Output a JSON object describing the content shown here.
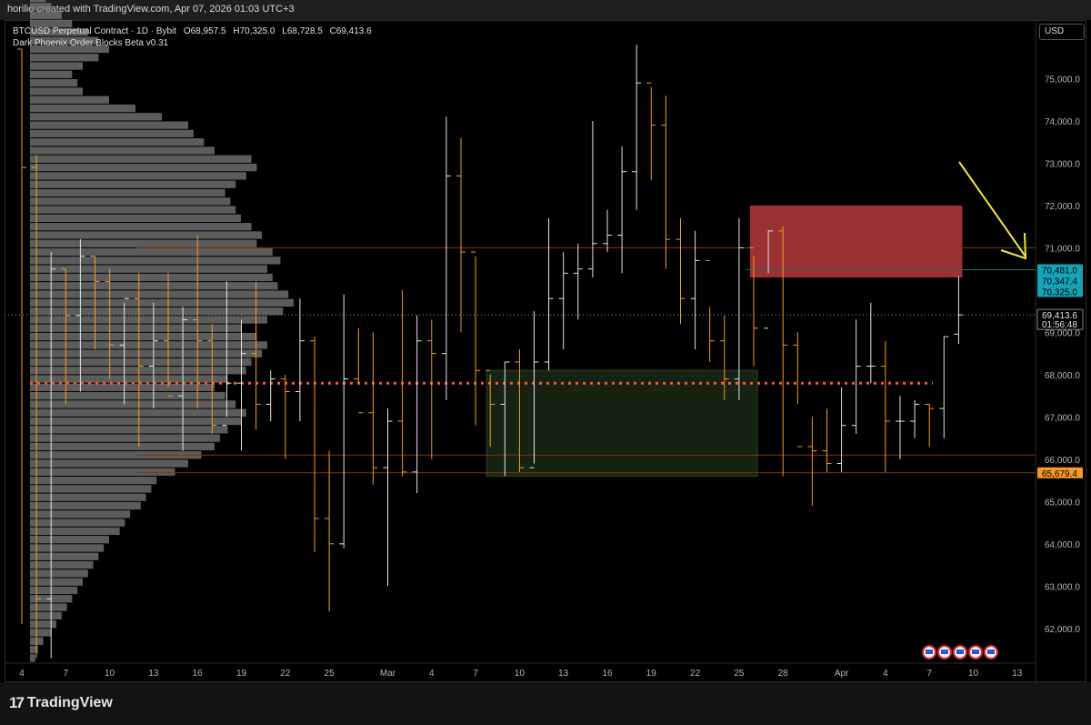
{
  "header": {
    "attribution": "horilio created with TradingView.com, Apr 07, 2026 01:03 UTC+3"
  },
  "legend": {
    "symbol": "BTCUSD Perpetual Contract · 1D · Bybit",
    "open": "O68,957.5",
    "high": "H70,325.0",
    "low": "L68,728.5",
    "close": "C69,413.6",
    "indicator": "Dark Phoenix Order Blocks Beta v0.31"
  },
  "currency": "USD",
  "brand": {
    "name": "TradingView"
  },
  "colors": {
    "up": "#e6e6e6",
    "down": "#f59a23",
    "bearish_block": "#b73a3d",
    "bullish_block": "#1c2b17",
    "poc": "#ff5a1f",
    "price_label": "#15a3b8",
    "support_label": "#f59a23",
    "arrow": "#f5e53a"
  },
  "chart_data": {
    "type": "ohlc",
    "y_ticks": [
      62000,
      63000,
      64000,
      65000,
      66000,
      67000,
      68000,
      69000,
      70000,
      71000,
      72000,
      73000,
      74000,
      75000
    ],
    "y_tick_labels": [
      "62,000.0",
      "63,000.0",
      "64,000.0",
      "65,000.0",
      "66,000.0",
      "67,000.0",
      "68,000.0",
      "69,000.0",
      "70,000.0",
      "71,000.0",
      "72,000.0",
      "73,000.0",
      "74,000.0",
      "75,000.0"
    ],
    "ylim": [
      61200,
      76000
    ],
    "x_labels": [
      {
        "i": 0,
        "label": "4"
      },
      {
        "i": 3,
        "label": "7"
      },
      {
        "i": 6,
        "label": "10"
      },
      {
        "i": 9,
        "label": "13"
      },
      {
        "i": 12,
        "label": "16"
      },
      {
        "i": 15,
        "label": "19"
      },
      {
        "i": 18,
        "label": "22"
      },
      {
        "i": 21,
        "label": "25"
      },
      {
        "i": 25,
        "label": "Mar"
      },
      {
        "i": 28,
        "label": "4"
      },
      {
        "i": 31,
        "label": "7"
      },
      {
        "i": 34,
        "label": "10"
      },
      {
        "i": 37,
        "label": "13"
      },
      {
        "i": 40,
        "label": "16"
      },
      {
        "i": 43,
        "label": "19"
      },
      {
        "i": 46,
        "label": "22"
      },
      {
        "i": 49,
        "label": "25"
      },
      {
        "i": 52,
        "label": "28"
      },
      {
        "i": 56,
        "label": "Apr"
      },
      {
        "i": 59,
        "label": "4"
      },
      {
        "i": 62,
        "label": "7"
      },
      {
        "i": 65,
        "label": "10"
      },
      {
        "i": 68,
        "label": "13"
      }
    ],
    "ohlc": [
      [
        75700,
        75700,
        62100,
        72900
      ],
      [
        72900,
        73200,
        61300,
        62700
      ],
      [
        62700,
        70900,
        61300,
        70500
      ],
      [
        70500,
        70500,
        67300,
        69400
      ],
      [
        69400,
        71200,
        67600,
        70800
      ],
      [
        70800,
        70800,
        68600,
        70200
      ],
      [
        70200,
        70500,
        67900,
        68700
      ],
      [
        68700,
        69700,
        67300,
        69800
      ],
      [
        69800,
        70400,
        66300,
        68200
      ],
      [
        68200,
        69700,
        67200,
        68800
      ],
      [
        68800,
        70400,
        67700,
        67500
      ],
      [
        67500,
        69600,
        66200,
        69300
      ],
      [
        69300,
        71300,
        67200,
        68800
      ],
      [
        68800,
        69200,
        66600,
        66800
      ],
      [
        66800,
        70200,
        67000,
        67800
      ],
      [
        67800,
        69300,
        66200,
        68500
      ],
      [
        68500,
        70200,
        66700,
        67300
      ],
      [
        67300,
        68100,
        66900,
        67900
      ],
      [
        67900,
        68000,
        66000,
        67600
      ],
      [
        67600,
        69800,
        66900,
        68800
      ],
      [
        68800,
        68900,
        63800,
        64600
      ],
      [
        64600,
        66200,
        62400,
        64000
      ],
      [
        64000,
        69900,
        63900,
        67900
      ],
      [
        67900,
        69100,
        67800,
        67100
      ],
      [
        67100,
        69000,
        65400,
        65800
      ],
      [
        65800,
        67200,
        63000,
        66900
      ],
      [
        66900,
        70000,
        65600,
        65700
      ],
      [
        65700,
        69400,
        65200,
        68800
      ],
      [
        68800,
        69300,
        66000,
        68500
      ],
      [
        68500,
        74100,
        67400,
        72700
      ],
      [
        72700,
        73600,
        69000,
        70900
      ],
      [
        70900,
        70800,
        66800,
        68100
      ],
      [
        68100,
        68000,
        66300,
        67300
      ],
      [
        67300,
        68300,
        65600,
        68300
      ],
      [
        68300,
        68600,
        65700,
        65800
      ],
      [
        65800,
        69500,
        65900,
        68300
      ],
      [
        68300,
        71700,
        68100,
        69800
      ],
      [
        69800,
        70900,
        68600,
        70400
      ],
      [
        70400,
        71100,
        69300,
        70500
      ],
      [
        70500,
        74000,
        70300,
        71100
      ],
      [
        71100,
        71900,
        70900,
        71300
      ],
      [
        71300,
        73400,
        70400,
        72800
      ],
      [
        72800,
        75800,
        71900,
        74900
      ],
      [
        74900,
        74800,
        72600,
        73900
      ],
      [
        73900,
        74600,
        70500,
        71200
      ],
      [
        71200,
        71700,
        69200,
        69800
      ],
      [
        69800,
        71400,
        68600,
        70700
      ],
      [
        70700,
        69600,
        68300,
        68800
      ],
      [
        68800,
        69400,
        67400,
        67900
      ],
      [
        67900,
        71700,
        67400,
        71000
      ],
      [
        71000,
        70800,
        68200,
        69100
      ],
      [
        69100,
        71400,
        70400,
        71400
      ],
      [
        71400,
        71500,
        65600,
        68700
      ],
      [
        68700,
        69000,
        67300,
        66300
      ],
      [
        66300,
        67000,
        64900,
        66200
      ],
      [
        66200,
        67200,
        65700,
        65900
      ],
      [
        65900,
        67700,
        65700,
        66800
      ],
      [
        66800,
        69300,
        66600,
        68200
      ],
      [
        68200,
        69700,
        67800,
        68200
      ],
      [
        68200,
        68800,
        65700,
        66900
      ],
      [
        66900,
        67500,
        66000,
        66900
      ],
      [
        66900,
        67400,
        66500,
        67300
      ],
      [
        67300,
        67300,
        66300,
        67200
      ],
      [
        67200,
        68900,
        66500,
        68900
      ],
      [
        68957.5,
        70325,
        68728.5,
        69413.6
      ]
    ],
    "volume_profile": {
      "bin_start": 61200,
      "bin_size": 200,
      "widths": [
        0.02,
        0.03,
        0.05,
        0.08,
        0.1,
        0.12,
        0.14,
        0.16,
        0.18,
        0.2,
        0.22,
        0.24,
        0.26,
        0.28,
        0.3,
        0.34,
        0.36,
        0.38,
        0.42,
        0.44,
        0.46,
        0.48,
        0.55,
        0.6,
        0.65,
        0.7,
        0.72,
        0.75,
        0.8,
        0.82,
        0.78,
        0.74,
        0.7,
        0.75,
        0.82,
        0.84,
        0.88,
        0.9,
        0.86,
        0.8,
        0.9,
        0.96,
        1.0,
        0.98,
        0.94,
        0.92,
        0.9,
        0.95,
        0.92,
        0.86,
        0.88,
        0.84,
        0.8,
        0.78,
        0.76,
        0.74,
        0.78,
        0.82,
        0.86,
        0.84,
        0.7,
        0.66,
        0.62,
        0.6,
        0.5,
        0.4,
        0.3,
        0.2,
        0.18,
        0.16,
        0.2,
        0.26,
        0.3,
        0.26,
        0.22,
        0.16,
        0.12,
        0.08,
        0.06,
        0.05,
        0.04
      ]
    },
    "order_blocks": [
      {
        "kind": "bearish",
        "i0": 50,
        "i1": 64,
        "y0": 70300,
        "y1": 72000
      },
      {
        "kind": "bullish",
        "i0": 32,
        "i1": 50,
        "y0": 65600,
        "y1": 68100
      }
    ],
    "levels": [
      {
        "y": 71000,
        "style": "orange-thin"
      },
      {
        "y": 70481,
        "style": "teal-thin"
      },
      {
        "y": 67800,
        "style": "poc-dotted"
      },
      {
        "y": 66100,
        "style": "orange-thin"
      },
      {
        "y": 65679.4,
        "style": "orange-thin"
      }
    ],
    "price_labels": [
      {
        "y": 70481,
        "text": "70,481.0",
        "kind": "teal"
      },
      {
        "y": 70347.4,
        "text": "70,347.4",
        "kind": "teal"
      },
      {
        "y": 70325,
        "text": "70,325.0",
        "kind": "teal"
      },
      {
        "y": 69413.6,
        "text": "69,413.6",
        "sub": "01:56:48",
        "kind": "current"
      },
      {
        "y": 65679.4,
        "text": "65,679.4",
        "kind": "orange"
      }
    ],
    "last_price": 69413.6
  }
}
